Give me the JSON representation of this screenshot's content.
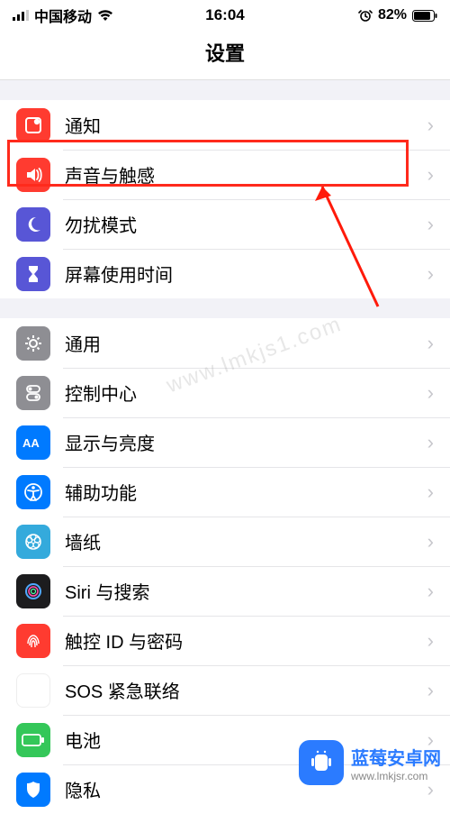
{
  "statusbar": {
    "carrier": "中国移动",
    "time": "16:04",
    "battery_pct": "82%"
  },
  "header": {
    "title": "设置"
  },
  "groups": [
    {
      "rows": [
        {
          "id": "notifications",
          "label": "通知"
        },
        {
          "id": "sounds",
          "label": "声音与触感",
          "highlight": true
        },
        {
          "id": "dnd",
          "label": "勿扰模式"
        },
        {
          "id": "screentime",
          "label": "屏幕使用时间"
        }
      ]
    },
    {
      "rows": [
        {
          "id": "general",
          "label": "通用"
        },
        {
          "id": "controlcenter",
          "label": "控制中心"
        },
        {
          "id": "display",
          "label": "显示与亮度"
        },
        {
          "id": "accessibility",
          "label": "辅助功能"
        },
        {
          "id": "wallpaper",
          "label": "墙纸"
        },
        {
          "id": "siri",
          "label": "Siri 与搜索"
        },
        {
          "id": "touchid",
          "label": "触控 ID 与密码"
        },
        {
          "id": "sos",
          "label": "SOS 紧急联络"
        },
        {
          "id": "battery",
          "label": "电池"
        },
        {
          "id": "privacy",
          "label": "隐私"
        }
      ]
    }
  ],
  "annotation": {
    "highlight_row_id": "sounds"
  },
  "watermark": {
    "text": "www.lmkjs1.com",
    "brand": "蓝莓安卓网",
    "brand_sub": "www.lmkjsr.com"
  }
}
